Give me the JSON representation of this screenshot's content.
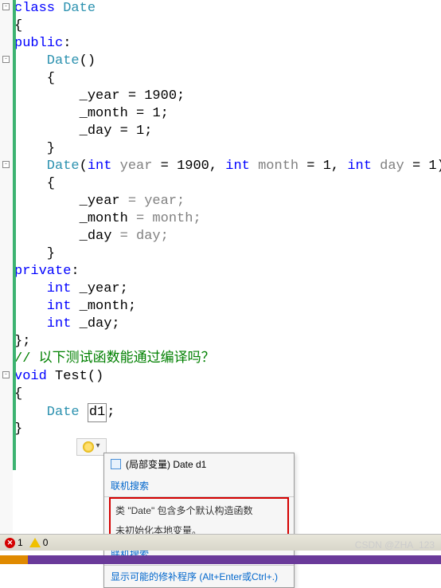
{
  "code": {
    "l1_kw": "class",
    "l1_type": " Date",
    "l2": "{",
    "l3_kw": "public",
    "l3_rest": ":",
    "l4_type": "    Date",
    "l4_rest": "()",
    "l5": "    {",
    "l6a": "        _year",
    "l6b": " = ",
    "l6c": "1900",
    "l6d": ";",
    "l7a": "        _month",
    "l7b": " = ",
    "l7c": "1",
    "l7d": ";",
    "l8a": "        _day",
    "l8b": " = ",
    "l8c": "1",
    "l8d": ";",
    "l9": "    }",
    "l10_type": "    Date",
    "l10a": "(",
    "l10_kw1": "int",
    "l10b": " year",
    "l10c": " = ",
    "l10d": "1900",
    "l10e": ", ",
    "l10_kw2": "int",
    "l10f": " month",
    "l10g": " = ",
    "l10h": "1",
    "l10i": ", ",
    "l10_kw3": "int",
    "l10j": " day",
    "l10k": " = ",
    "l10l": "1",
    "l10m": ")",
    "l11": "    {",
    "l12a": "        _year",
    "l12b": " = year;",
    "l13a": "        _month",
    "l13b": " = month;",
    "l14a": "        _day",
    "l14b": " = day;",
    "l15": "    }",
    "l16_kw": "private",
    "l16_rest": ":",
    "l17_kw": "    int",
    "l17_rest": " _year;",
    "l18_kw": "    int",
    "l18_rest": " _month;",
    "l19_kw": "    int",
    "l19_rest": " _day;",
    "l20": "};",
    "l21": "// 以下测试函数能通过编译吗？",
    "l22_kw": "void",
    "l22a": " ",
    "l22b": "Test",
    "l22c": "()",
    "l23": "{",
    "l24_type": "    Date",
    "l24a": " ",
    "l24b": "d1",
    "l24c": ";",
    "l25": "}"
  },
  "tooltip": {
    "header_prefix": "(局部变量) ",
    "header_type": "Date d1",
    "link1": "联机搜索",
    "err1": "类 \"Date\" 包含多个默认构造函数",
    "err2": "未初始化本地变量。",
    "link2": "联机搜索",
    "fix": "显示可能的修补程序 (Alt+Enter或Ctrl+.)"
  },
  "status": {
    "errors": "1",
    "warnings": "0"
  },
  "watermark": "CSDN @ZHA_123"
}
